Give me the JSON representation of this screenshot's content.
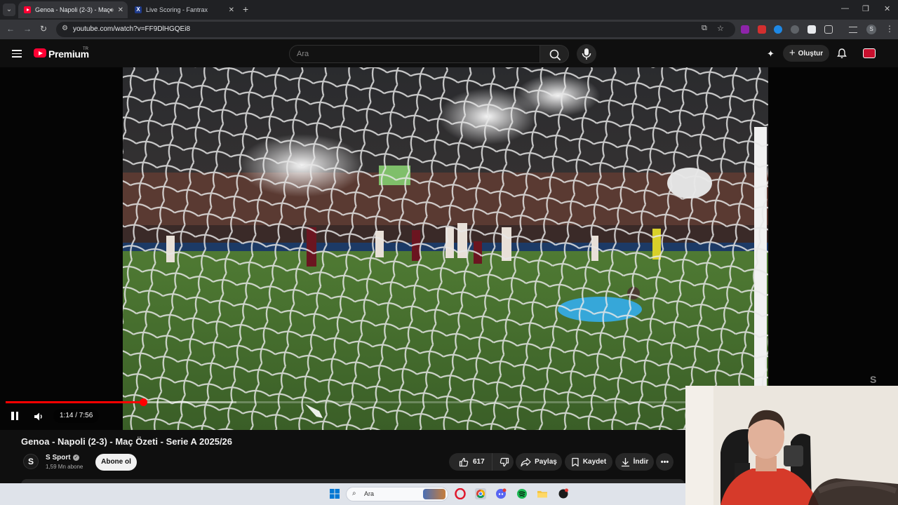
{
  "browser": {
    "tabs": [
      {
        "title": "Genoa - Napoli (2-3) - Maç",
        "active": true,
        "playing_audio": true
      },
      {
        "title": "Live Scoring - Fantrax",
        "active": false
      }
    ],
    "url": "youtube.com/watch?v=FF9DlHGQEi8"
  },
  "youtube": {
    "brand": "Premium",
    "region": "TR",
    "search_placeholder": "Ara",
    "create_label": "Oluştur"
  },
  "player": {
    "current_time": "1:14",
    "duration": "7:56",
    "time_display": "1:14 / 7:56",
    "progress_played": 0.155,
    "progress_buffered": 0.26,
    "watermark": "S"
  },
  "video": {
    "title": "Genoa - Napoli (2-3) - Maç Özeti - Serie A 2025/26",
    "channel_name": "S Sport",
    "channel_initial": "S",
    "subscribers": "1,59 Mn abone",
    "subscribe_label": "Abone ol",
    "likes": "617",
    "share_label": "Paylaş",
    "save_label": "Kaydet",
    "download_label": "İndir"
  },
  "taskbar": {
    "search_label": "Ara"
  },
  "colors": {
    "accent": "#ff0000",
    "yt_red": "#ff0033",
    "background": "#0f0f0f"
  }
}
